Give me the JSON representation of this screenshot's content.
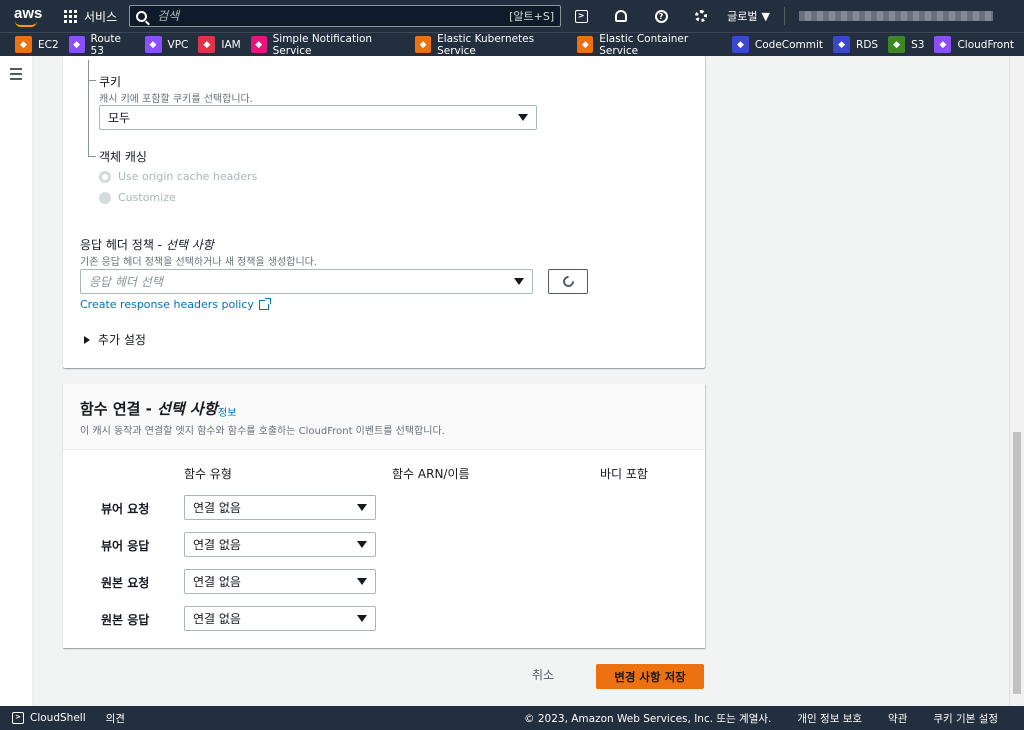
{
  "topnav": {
    "logo": "aws",
    "services_label": "서비스",
    "search_placeholder": "검색",
    "search_shortcut": "[알트+S]",
    "region_label": "글로벌"
  },
  "favorites": [
    {
      "label": "EC2",
      "color": "#ec7211",
      "icon": "ec2-icon"
    },
    {
      "label": "Route 53",
      "color": "#8c4fff",
      "icon": "route53-icon"
    },
    {
      "label": "VPC",
      "color": "#8c4fff",
      "icon": "vpc-icon"
    },
    {
      "label": "IAM",
      "color": "#dd344c",
      "icon": "iam-icon"
    },
    {
      "label": "Simple Notification Service",
      "color": "#e7157b",
      "icon": "sns-icon"
    },
    {
      "label": "Elastic Kubernetes Service",
      "color": "#ec7211",
      "icon": "eks-icon"
    },
    {
      "label": "Elastic Container Service",
      "color": "#ec7211",
      "icon": "ecs-icon"
    },
    {
      "label": "CodeCommit",
      "color": "#3b48cc",
      "icon": "codecommit-icon"
    },
    {
      "label": "RDS",
      "color": "#3b48cc",
      "icon": "rds-icon"
    },
    {
      "label": "S3",
      "color": "#3f8624",
      "icon": "s3-icon"
    },
    {
      "label": "CloudFront",
      "color": "#8c4fff",
      "icon": "cloudfront-icon"
    }
  ],
  "cache": {
    "cookie_label": "쿠키",
    "cookie_desc": "캐시 키에 포함할 쿠키를 선택합니다.",
    "cookie_value": "모두",
    "object_caching_label": "객체 캐싱",
    "radio_origin": "Use origin cache headers",
    "radio_customize": "Customize"
  },
  "response_headers": {
    "label_prefix": "응답 헤더 정책 - ",
    "label_optional": "선택 사항",
    "desc": "기존 응답 헤더 정책을 선택하거나 새 정책을 생성합니다.",
    "placeholder": "응답 헤더 선택",
    "create_link": "Create response headers policy",
    "additional_settings": "추가 설정"
  },
  "functions": {
    "title_prefix": "함수 연결 - ",
    "title_optional": "선택 사항",
    "info_link": "정보",
    "desc": "이 캐시 동작과 연결할 엣지 함수와 함수를 호출하는 CloudFront 이벤트를 선택합니다.",
    "col_type": "함수 유형",
    "col_arn": "함수 ARN/이름",
    "col_body": "바디 포함",
    "rows": [
      {
        "label": "뷰어 요청",
        "value": "연결 없음"
      },
      {
        "label": "뷰어 응답",
        "value": "연결 없음"
      },
      {
        "label": "원본 요청",
        "value": "연결 없음"
      },
      {
        "label": "원본 응답",
        "value": "연결 없음"
      }
    ]
  },
  "actions": {
    "cancel": "취소",
    "save": "변경 사항 저장"
  },
  "footer": {
    "cloudshell": "CloudShell",
    "feedback": "의견",
    "copyright": "© 2023, Amazon Web Services, Inc. 또는 계열사.",
    "privacy": "개인 정보 보호",
    "terms": "약관",
    "cookies": "쿠키 기본 설정"
  }
}
